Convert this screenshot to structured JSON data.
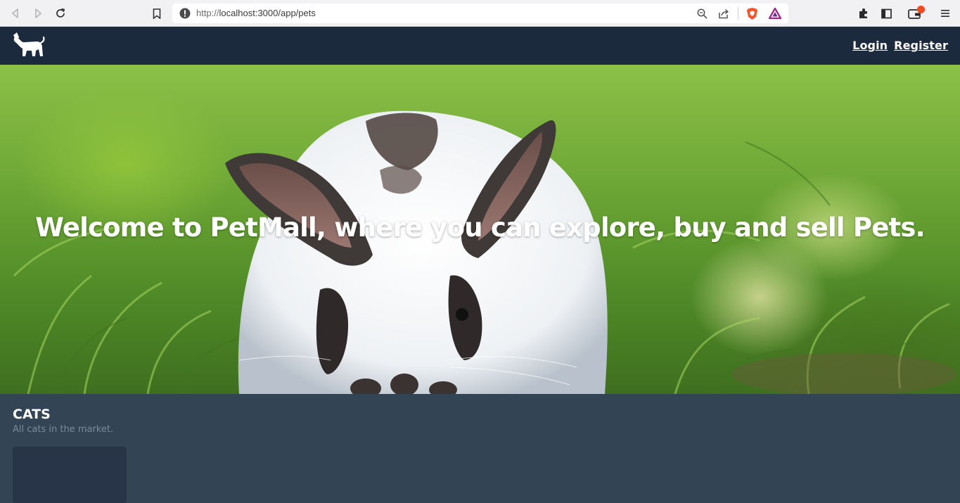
{
  "browser": {
    "url_scheme": "http://",
    "url_rest": "localhost:3000/app/pets",
    "icons": [
      "back-icon",
      "forward-icon",
      "reload-icon",
      "bookmark-icon",
      "site-info-icon",
      "zoom-icon",
      "share-icon",
      "brave-shield-icon",
      "brave-rewards-icon",
      "extensions-icon",
      "sidebar-icon",
      "wallet-icon",
      "menu-icon"
    ]
  },
  "header": {
    "logo_icon": "dog-logo-icon",
    "login_label": "Login",
    "register_label": "Register"
  },
  "hero": {
    "title": "Welcome to PetMall, where you can explore, buy and sell Pets."
  },
  "section": {
    "title": "CATS",
    "subtitle": "All cats in the market."
  },
  "colors": {
    "header_bg": "#1c2a3d",
    "page_bg": "#334455",
    "card_bg": "#283548",
    "subtitle": "#7c8a99"
  }
}
